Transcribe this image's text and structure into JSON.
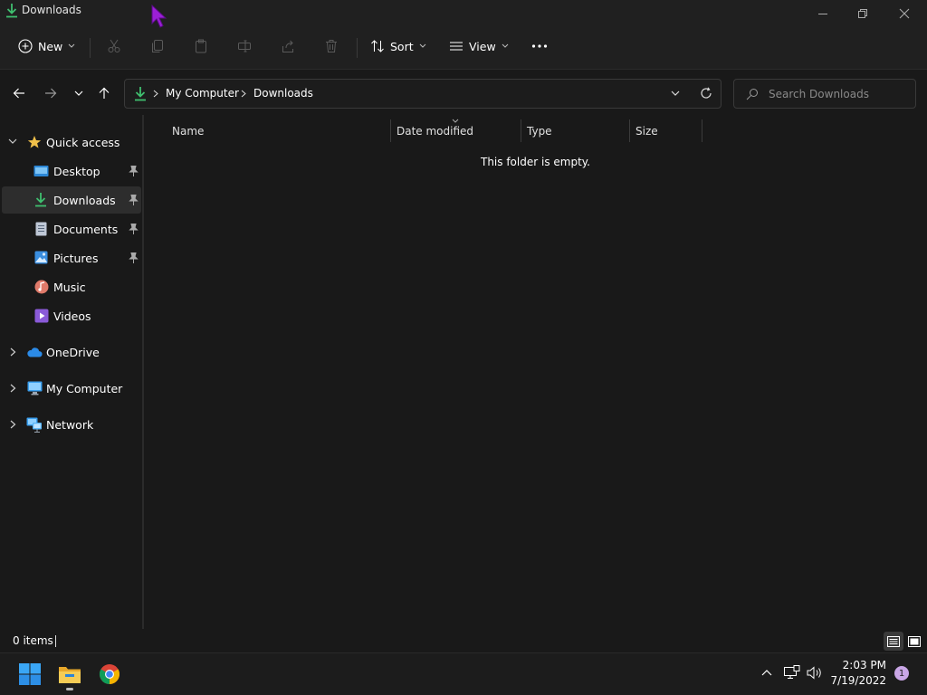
{
  "window": {
    "title": "Downloads"
  },
  "commandbar": {
    "new_label": "New",
    "sort_label": "Sort",
    "view_label": "View"
  },
  "address": {
    "crumbs": [
      "My Computer",
      "Downloads"
    ]
  },
  "search": {
    "placeholder": "Search Downloads"
  },
  "sidebar": {
    "quick_access": "Quick access",
    "items": [
      {
        "label": "Desktop",
        "pinned": true
      },
      {
        "label": "Downloads",
        "pinned": true,
        "selected": true
      },
      {
        "label": "Documents",
        "pinned": true
      },
      {
        "label": "Pictures",
        "pinned": true
      },
      {
        "label": "Music",
        "pinned": false
      },
      {
        "label": "Videos",
        "pinned": false
      }
    ],
    "roots": [
      "OneDrive",
      "My Computer",
      "Network"
    ]
  },
  "columns": [
    "Name",
    "Date modified",
    "Type",
    "Size"
  ],
  "content": {
    "empty_message": "This folder is empty."
  },
  "status": {
    "item_count": "0 items"
  },
  "taskbar": {
    "time": "2:03 PM",
    "date": "7/19/2022",
    "notification_count": "1"
  },
  "colors": {
    "background": "#191919",
    "chrome": "#202020",
    "selected": "#2d2d2d",
    "download_green": "#3fbf6f",
    "folder_yellow": "#f0c04a",
    "accent_blue": "#3aa0f0"
  }
}
